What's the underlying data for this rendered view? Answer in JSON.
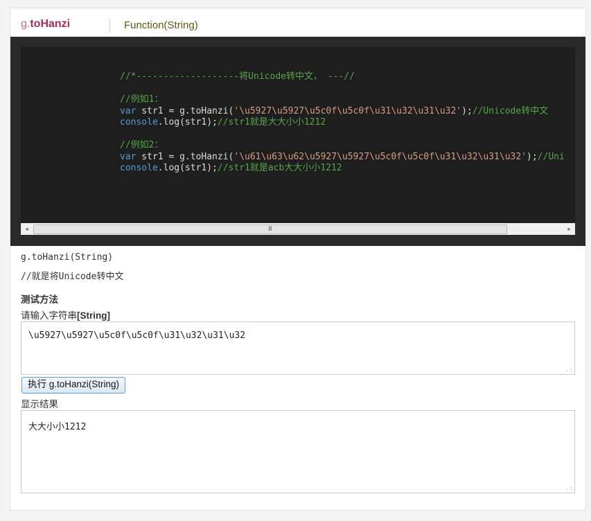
{
  "header": {
    "namespace": "g.",
    "function_name": "toHanzi",
    "signature": "Function(String)"
  },
  "code": {
    "comment_title": "//*-------------------将Unicode转中文， ---//",
    "example1_comment": "//例如1：",
    "example1_var": "var",
    "example1_pre": " str1 = g.toHanzi(",
    "example1_str": "'\\u5927\\u5927\\u5c0f\\u5c0f\\u31\\u32\\u31\\u32'",
    "example1_post": ");",
    "example1_tail_comment": "//Unicode转中文",
    "example1_console": "console",
    "example1_log": ".log(str1);",
    "example1_log_comment": "//str1就是大大小小1212",
    "example2_comment": "//例如2：",
    "example2_var": "var",
    "example2_pre": " str1 = g.toHanzi(",
    "example2_str": "'\\u61\\u63\\u62\\u5927\\u5927\\u5c0f\\u5c0f\\u31\\u32\\u31\\u32'",
    "example2_post": ");",
    "example2_tail_comment": "//Uni",
    "example2_console": "console",
    "example2_log": ".log(str1);",
    "example2_log_comment": "//str1就是acb大大小小1212"
  },
  "scrollbar": {
    "left_arrow": "◂",
    "right_arrow": "▸",
    "grip": "III"
  },
  "description": {
    "usage": "g.toHanzi(String)",
    "note": "//就是将Unicode转中文"
  },
  "test": {
    "heading": "测试方法",
    "input_label_prefix": "请输入字符串",
    "input_label_type": "[String]",
    "input_value": "\\u5927\\u5927\\u5c0f\\u5c0f\\u31\\u32\\u31\\u32",
    "run_button": "执行 g.toHanzi(String)",
    "result_label": "显示结果",
    "result_value": "大大小小1212",
    "resize_grip": ".:"
  }
}
